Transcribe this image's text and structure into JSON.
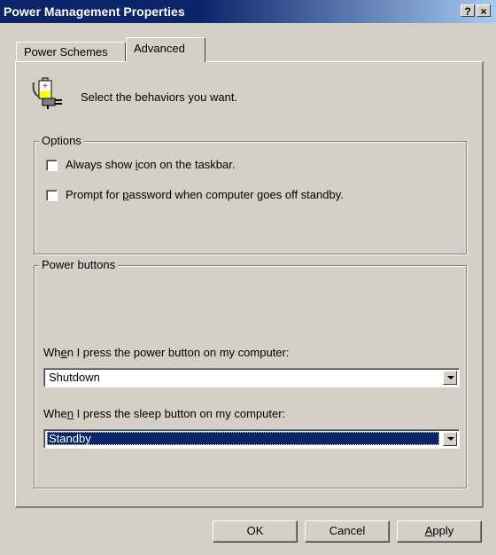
{
  "window": {
    "title": "Power Management Properties",
    "help_label": "?",
    "close_label": "×"
  },
  "tabs": [
    {
      "label": "Power Schemes",
      "selected": false
    },
    {
      "label": "Advanced",
      "selected": true
    }
  ],
  "intro": {
    "text": "Select the behaviors you want.",
    "icon": "power-plug-battery-icon"
  },
  "options": {
    "legend": "Options",
    "items": [
      {
        "label_before": "Always show ",
        "mnemonic": "i",
        "label_after": "con on the taskbar.",
        "checked": false
      },
      {
        "label_before": "Prompt for ",
        "mnemonic": "p",
        "label_after": "assword when computer goes off standby.",
        "checked": false
      }
    ]
  },
  "power_buttons": {
    "legend": "Power buttons",
    "power": {
      "label_before": "Wh",
      "mnemonic": "e",
      "label_after": "n I press the power button on my computer:",
      "value": "Shutdown"
    },
    "sleep": {
      "label_before": "Whe",
      "mnemonic": "n",
      "label_after": " I press the sleep button on my computer:",
      "value": "Standby"
    }
  },
  "buttons": {
    "ok": "OK",
    "cancel": "Cancel",
    "apply_mnemonic": "A",
    "apply_rest": "pply"
  }
}
